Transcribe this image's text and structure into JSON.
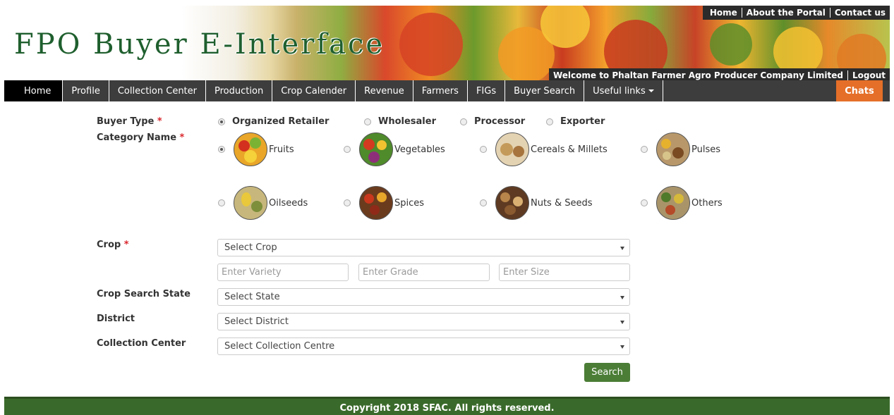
{
  "header": {
    "title": "FPO Buyer E-Interface",
    "top_links": [
      "Home",
      "About the Portal",
      "Contact us"
    ],
    "welcome": "Welcome to Phaltan Farmer Agro Producer Company Limited",
    "logout": "Logout"
  },
  "nav": {
    "items": [
      "Home",
      "Profile",
      "Collection Center",
      "Production",
      "Crop Calender",
      "Revenue",
      "Farmers",
      "FIGs",
      "Buyer Search",
      "Useful links"
    ],
    "active": "Home",
    "chats": "Chats"
  },
  "form": {
    "buyer_type": {
      "label": "Buyer Type",
      "required": "*",
      "options": [
        "Organized Retailer",
        "Wholesaler",
        "Processor",
        "Exporter"
      ],
      "selected": "Organized Retailer"
    },
    "category": {
      "label": "Category Name",
      "required": "*",
      "options": [
        "Fruits",
        "Vegetables",
        "Cereals & Millets",
        "Pulses",
        "Oilseeds",
        "Spices",
        "Nuts & Seeds",
        "Others"
      ],
      "selected": "Fruits",
      "icons": [
        "fruits-basket-icon",
        "vegetables-icon",
        "cereals-millets-icon",
        "pulses-icon",
        "oilseeds-icon",
        "spices-icon",
        "nuts-seeds-icon",
        "others-grains-icon"
      ]
    },
    "crop": {
      "label": "Crop",
      "required": "*",
      "value": "Select Crop"
    },
    "variety_placeholder": "Enter Variety",
    "grade_placeholder": "Enter Grade",
    "size_placeholder": "Enter Size",
    "state": {
      "label": "Crop Search State",
      "value": "Select State"
    },
    "district": {
      "label": "District",
      "value": "Select District"
    },
    "collection_center": {
      "label": "Collection Center",
      "value": "Select Collection Centre"
    },
    "search_button": "Search"
  },
  "footer": {
    "copyright": "Copyright 2018 SFAC. All rights reserved."
  },
  "colors": {
    "nav_bg": "#3d3d3d",
    "chats": "#e56f28",
    "search_button": "#4b7d36",
    "footer": "#3a6a2b",
    "required": "#d9262c",
    "title": "#1f5f2e"
  }
}
